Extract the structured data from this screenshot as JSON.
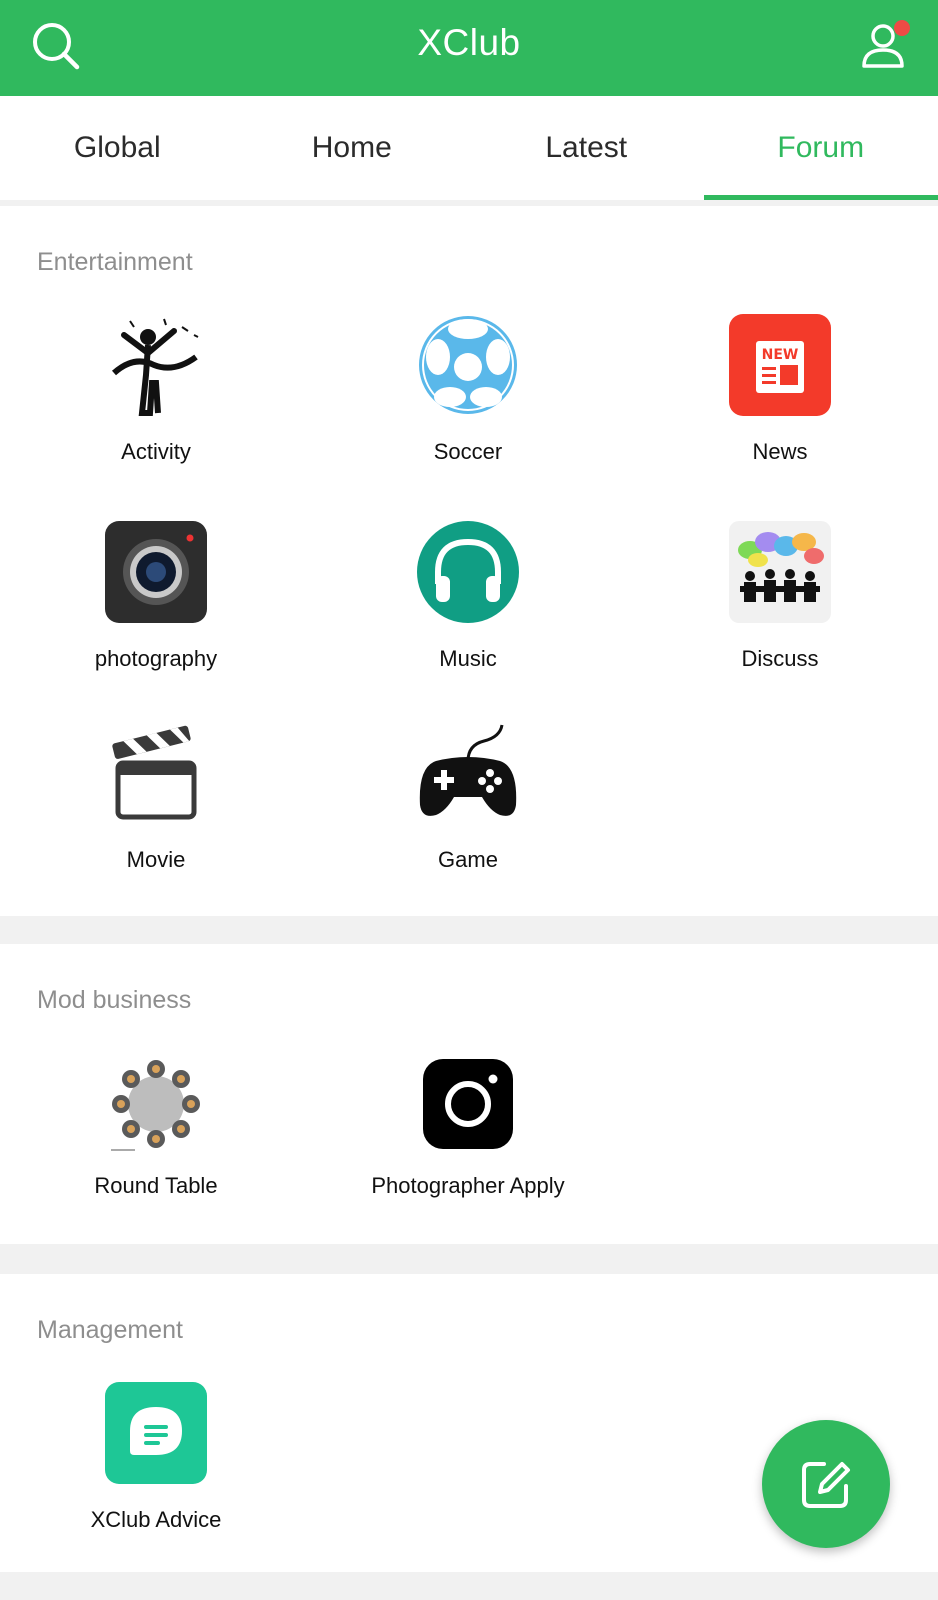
{
  "appbar": {
    "title": "XClub"
  },
  "tabs": [
    "Global",
    "Home",
    "Latest",
    "Forum"
  ],
  "active_tab": "Forum",
  "colors": {
    "brand": "#30b95e",
    "notification": "#ee4b45",
    "section_header": "#8e8e8e"
  },
  "sections": [
    {
      "title": "Entertainment",
      "items": [
        {
          "label": "Activity",
          "icon": "finish-line-runner-icon"
        },
        {
          "label": "Soccer",
          "icon": "soccer-ball-icon"
        },
        {
          "label": "News",
          "icon": "news-icon"
        },
        {
          "label": "photography",
          "icon": "camera-icon"
        },
        {
          "label": "Music",
          "icon": "headphones-icon"
        },
        {
          "label": "Discuss",
          "icon": "discussion-group-icon"
        },
        {
          "label": "Movie",
          "icon": "clapperboard-icon"
        },
        {
          "label": "Game",
          "icon": "gamepad-icon"
        }
      ]
    },
    {
      "title": "Mod business",
      "items": [
        {
          "label": "Round Table",
          "icon": "round-table-icon"
        },
        {
          "label": "Photographer Apply",
          "icon": "instagram-camera-icon"
        }
      ]
    },
    {
      "title": "Management",
      "items": [
        {
          "label": "XClub Advice",
          "icon": "chat-bubble-icon"
        }
      ]
    }
  ],
  "fab": {
    "icon": "edit-icon"
  }
}
